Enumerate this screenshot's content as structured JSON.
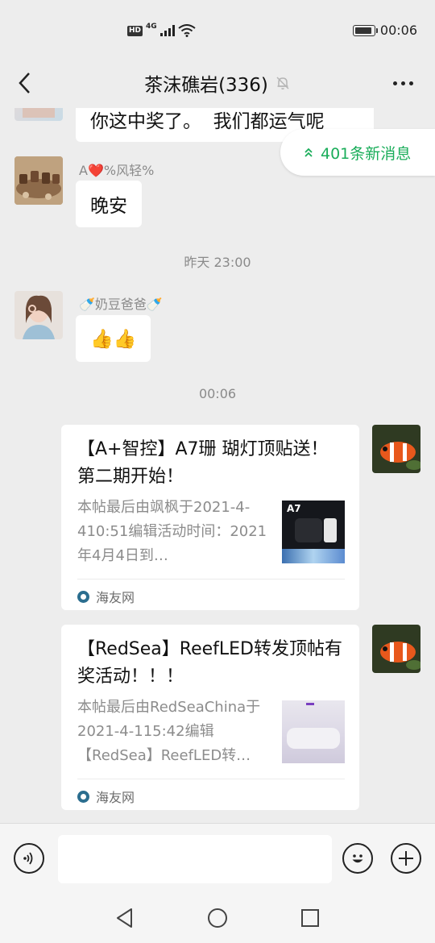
{
  "status_bar": {
    "network_badge": "HD",
    "network_type": "4G",
    "battery_level": 0.9,
    "time": "00:06"
  },
  "header": {
    "title": "茶沫礁岩(336)",
    "icons": [
      "back-arrow-icon",
      "mute-bell-icon",
      "more-icon"
    ]
  },
  "new_messages_pill": {
    "label": "401条新消息",
    "icon": "double-chevron-up-icon",
    "color": "#1aad5a"
  },
  "messages": [
    {
      "type": "text",
      "side": "left",
      "sender": "",
      "text": "你这中奖了。  我们都运气呢",
      "partially_visible": true
    },
    {
      "type": "text",
      "side": "left",
      "sender": "A❤️%风轻%",
      "text": "晚安"
    },
    {
      "type": "timestamp",
      "text": "昨天 23:00"
    },
    {
      "type": "text",
      "side": "left",
      "sender": "🍼奶豆爸爸🍼",
      "text": "👍👍"
    },
    {
      "type": "timestamp",
      "text": "00:06"
    },
    {
      "type": "link_card",
      "side": "right",
      "title": "【A+智控】A7珊 瑚灯顶贴送！第二期开始！",
      "desc": "本帖最后由飒枫于2021-4-410:51编辑活动时间：2021年4月4日到…",
      "thumb_label": "A7",
      "source": "海友网"
    },
    {
      "type": "link_card",
      "side": "right",
      "title": "【RedSea】ReefLED转发顶帖有奖活动！！！",
      "desc": "本帖最后由RedSeaChina于2021-4-115:42编辑【RedSea】ReefLED转…",
      "source": "海友网"
    }
  ],
  "input_bar": {
    "placeholder": "",
    "icons": [
      "voice-icon",
      "emoji-icon",
      "plus-icon"
    ]
  },
  "system_nav": {
    "icons": [
      "nav-back-icon",
      "nav-home-icon",
      "nav-recents-icon"
    ]
  }
}
